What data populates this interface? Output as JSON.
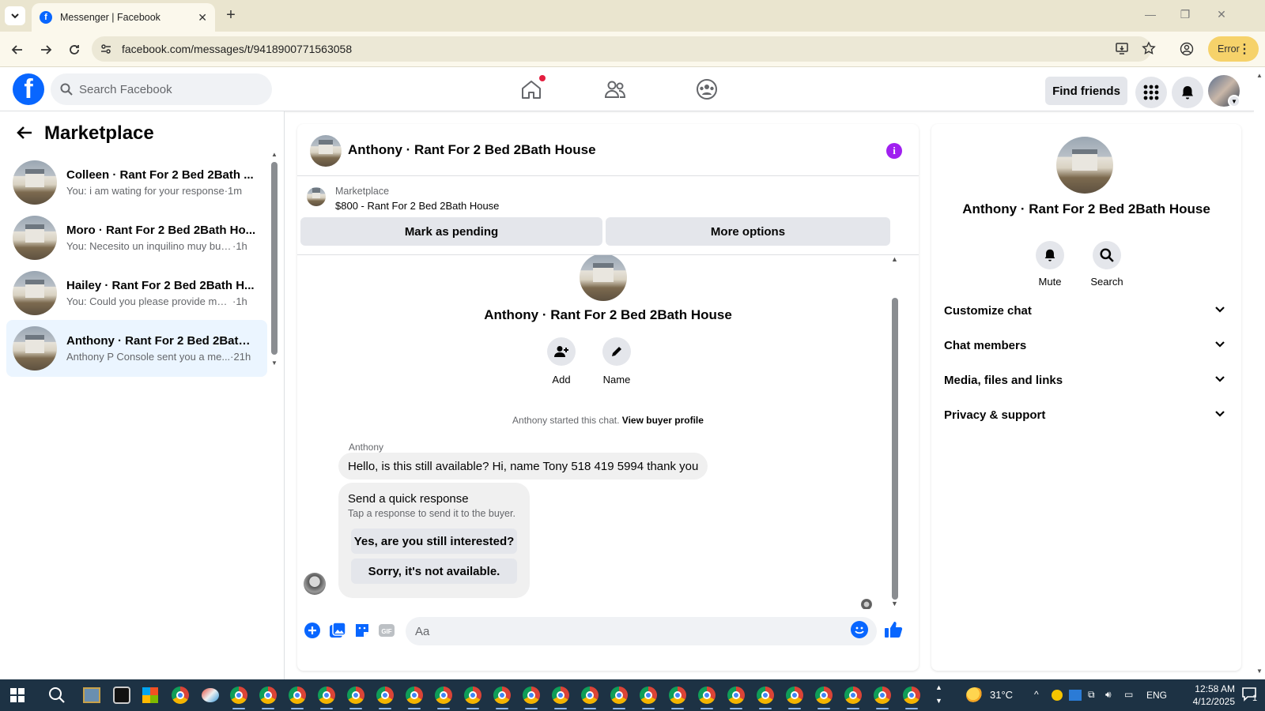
{
  "browser": {
    "tab_title": "Messenger | Facebook",
    "url": "facebook.com/messages/t/9418900771563058",
    "error_label": "Error"
  },
  "header": {
    "search_placeholder": "Search Facebook",
    "find_friends_label": "Find friends"
  },
  "sidebar": {
    "title": "Marketplace",
    "conversations": [
      {
        "name": "Colleen · Rant For 2 Bed 2Bath ...",
        "snippet": "You: i am wating for your response",
        "time": "·1m",
        "active": false
      },
      {
        "name": "Moro · Rant For 2 Bed 2Bath Ho...",
        "snippet": "You: Necesito un inquilino muy bue...",
        "time": "·1h",
        "active": false
      },
      {
        "name": "Hailey · Rant For 2 Bed 2Bath H...",
        "snippet": "You: Could you please provide me ...",
        "time": "·1h",
        "active": false
      },
      {
        "name": "Anthony · Rant For 2 Bed 2Bath ...",
        "snippet": "Anthony P Console sent you a me...",
        "time": "·21h",
        "active": true
      }
    ]
  },
  "chat": {
    "title": "Anthony · Rant For 2 Bed 2Bath House",
    "marketplace_label": "Marketplace",
    "listing": "$800 - Rant For 2 Bed 2Bath House",
    "mark_pending_label": "Mark as pending",
    "more_options_label": "More options",
    "intro_name": "Anthony · Rant For 2 Bed 2Bath House",
    "add_label": "Add",
    "name_label": "Name",
    "started_text": "Anthony started this chat.",
    "view_profile_label": "View buyer profile",
    "sender": "Anthony",
    "message": "Hello, is this still available? Hi, name Tony 518 419 5994 thank you",
    "quick_title": "Send a quick response",
    "quick_sub": "Tap a response to send it to the buyer.",
    "quick_replies": [
      "Yes, are you still interested?",
      "Sorry, it's not available."
    ],
    "input_placeholder": "Aa"
  },
  "info_panel": {
    "name": "Anthony · Rant For 2 Bed 2Bath House",
    "mute_label": "Mute",
    "search_label": "Search",
    "sections": [
      "Customize chat",
      "Chat members",
      "Media, files and links",
      "Privacy & support"
    ]
  },
  "taskbar": {
    "temperature": "31°C",
    "language": "ENG",
    "time": "12:58 AM",
    "date": "4/12/2025",
    "notification_count": "1"
  },
  "colors": {
    "accent": "#0866ff",
    "active_row": "#ebf5ff",
    "info_icon": "#a020f0"
  }
}
